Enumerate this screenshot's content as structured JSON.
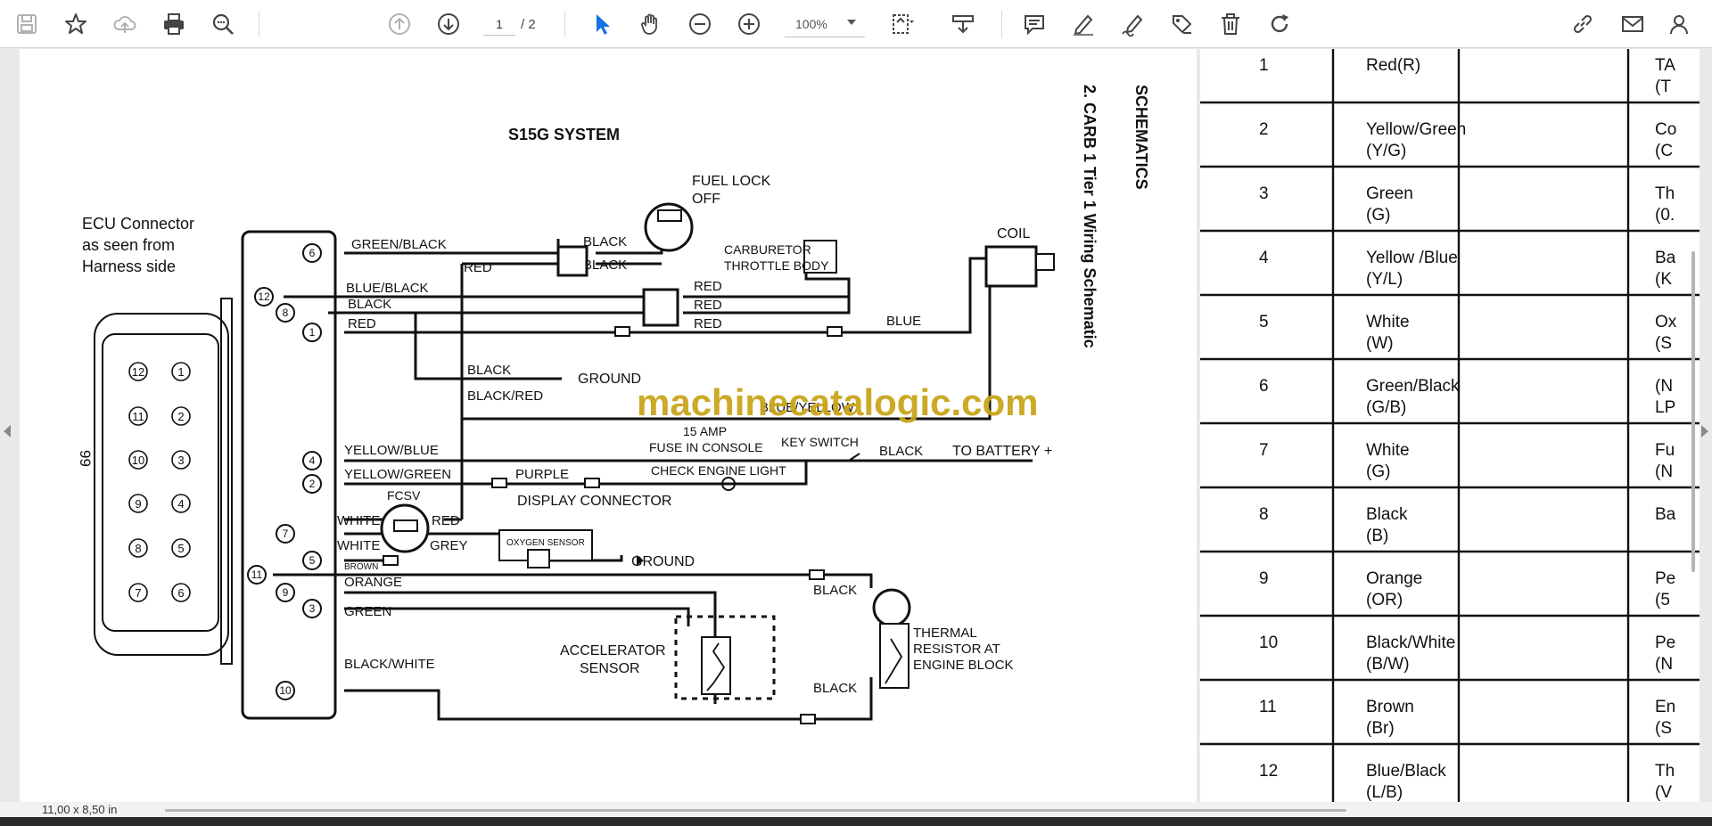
{
  "toolbar": {
    "icons": [
      "save-icon",
      "star-icon",
      "upload-cloud-icon",
      "print-icon",
      "zoom-search-icon",
      "page-up-icon",
      "page-down-icon",
      "select-arrow-icon",
      "hand-pan-icon",
      "zoom-out-icon",
      "zoom-in-icon",
      "fit-page-icon",
      "scroll-mode-icon",
      "comment-icon",
      "highlight-pen-icon",
      "draw-signature-icon",
      "stamp-icon",
      "delete-icon",
      "rotate-icon",
      "share-link-icon",
      "email-icon",
      "account-icon"
    ],
    "current_page": "1",
    "total_pages": "/ 2",
    "zoom": "100%"
  },
  "status": {
    "page_size": "11,00 x 8,50 in"
  },
  "schematic": {
    "title": "S15G SYSTEM",
    "side_title": "SCHEMATICS",
    "side_subtitle": "2. CARB 1 Tier 1 Wiring Schematic",
    "page_number": "99",
    "watermark": "machinecatalogic.com",
    "ecu_label_1": "ECU Connector",
    "ecu_label_2": "as seen from",
    "ecu_label_3": "Harness side",
    "connector_left_pins": [
      "12",
      "11",
      "10",
      "9",
      "8",
      "7"
    ],
    "connector_right_pins": [
      "1",
      "2",
      "3",
      "4",
      "5",
      "6"
    ],
    "fuel_lock_1": "FUEL LOCK",
    "fuel_lock_2": "OFF",
    "carb_1": "CARBURETOR",
    "carb_2": "THROTTLE BODY",
    "coil": "COIL",
    "ground": "GROUND",
    "fuse_1": "15 AMP",
    "fuse_2": "FUSE IN CONSOLE",
    "key_switch": "KEY SWITCH",
    "to_battery": "TO BATTERY +",
    "check_engine": "CHECK ENGINE LIGHT",
    "display_connector": "DISPLAY CONNECTOR",
    "fcsv": "FCSV",
    "oxygen_sensor": "OXYGEN SENSOR",
    "accel_1": "ACCELERATOR",
    "accel_2": "SENSOR",
    "thermal_1": "THERMAL",
    "thermal_2": "RESISTOR AT",
    "thermal_3": "ENGINE BLOCK",
    "wires": {
      "green_black": "GREEN/BLACK",
      "blue_black": "BLUE/BLACK",
      "black": "BLACK",
      "red": "RED",
      "black_red": "BLACK/RED",
      "blue_yellow": "BLUE/YELLOW",
      "yellow_blue": "YELLOW/BLUE",
      "yellow_green": "YELLOW/GREEN",
      "purple": "PURPLE",
      "white": "WHITE",
      "grey": "GREY",
      "brown": "BROWN",
      "orange": "ORANGE",
      "green": "GREEN",
      "black_white": "BLACK/WHITE",
      "blue": "BLUE"
    },
    "pins": {
      "p6": "6",
      "p12": "12",
      "p8": "8",
      "p1": "1",
      "p4": "4",
      "p2": "2",
      "p7": "7",
      "p5": "5",
      "p11": "11",
      "p9": "9",
      "p3": "3",
      "p10": "10"
    }
  },
  "pin_table": {
    "first_row_desc_1": "TA",
    "first_row_desc_2": "(T",
    "rows": [
      {
        "pin": "1",
        "color": "Red(R)",
        "abbr": "",
        "d1": "TA",
        "d2": "(T"
      },
      {
        "pin": "2",
        "color": "Yellow/Green",
        "abbr": "(Y/G)",
        "d1": "Co",
        "d2": "(C"
      },
      {
        "pin": "3",
        "color": "Green",
        "abbr": "(G)",
        "d1": "Th",
        "d2": "(0."
      },
      {
        "pin": "4",
        "color": "Yellow /Blue",
        "abbr": "(Y/L)",
        "d1": "Ba",
        "d2": "(K"
      },
      {
        "pin": "5",
        "color": "White",
        "abbr": "(W)",
        "d1": "Ox",
        "d2": "(S"
      },
      {
        "pin": "6",
        "color": "Green/Black",
        "abbr": "(G/B)",
        "d1": "(N",
        "d2": "LP"
      },
      {
        "pin": "7",
        "color": "White",
        "abbr": "(G)",
        "d1": "Fu",
        "d2": "(N"
      },
      {
        "pin": "8",
        "color": "Black",
        "abbr": "(B)",
        "d1": "Ba",
        "d2": ""
      },
      {
        "pin": "9",
        "color": "Orange",
        "abbr": "(OR)",
        "d1": "Pe",
        "d2": "(5"
      },
      {
        "pin": "10",
        "color": "Black/White",
        "abbr": "(B/W)",
        "d1": "Pe",
        "d2": "(N"
      },
      {
        "pin": "11",
        "color": "Brown",
        "abbr": "(Br)",
        "d1": "En",
        "d2": "(S"
      },
      {
        "pin": "12",
        "color": "Blue/Black",
        "abbr": "(L/B)",
        "d1": "Th",
        "d2": "(V"
      }
    ]
  }
}
